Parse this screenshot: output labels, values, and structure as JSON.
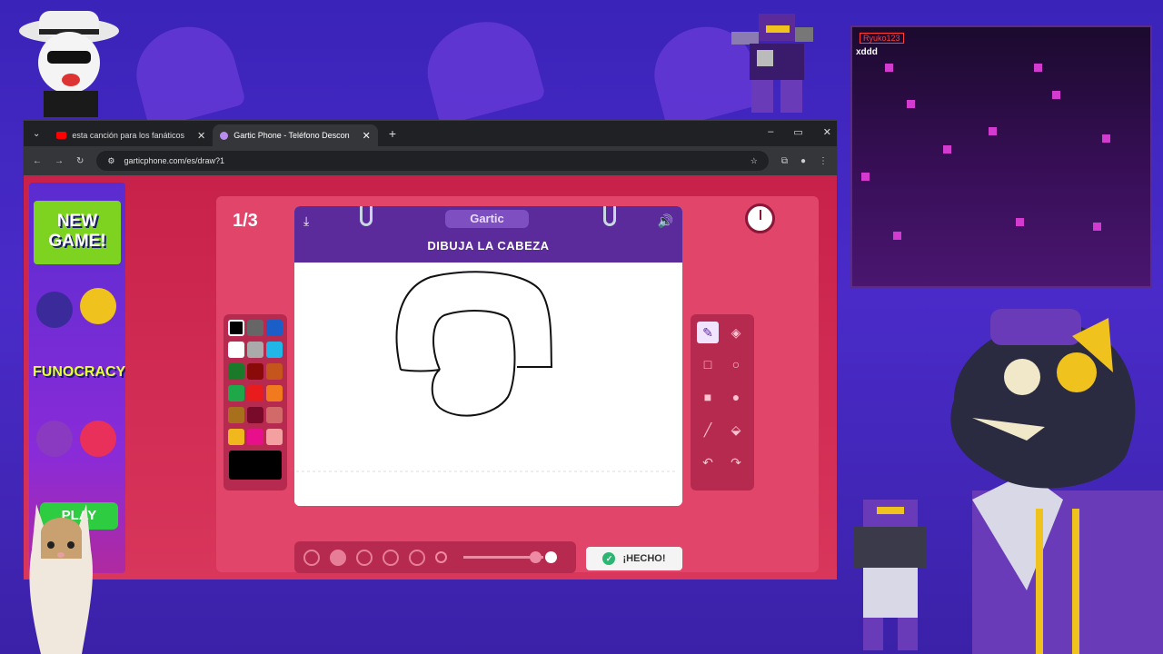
{
  "chat": {
    "username": "Ryuko123",
    "message": "xddd"
  },
  "browser": {
    "tabs": [
      {
        "label": "esta canción para los fanáticos",
        "icon": "youtube-icon",
        "active": false
      },
      {
        "label": "Gartic Phone - Teléfono Descon",
        "icon": "gartic-icon",
        "active": true
      }
    ],
    "new_tab": "+",
    "url": "garticphone.com/es/draw?1",
    "window_controls": [
      "–",
      "▭",
      "✕"
    ]
  },
  "ad": {
    "title": "NEW GAME!",
    "brand": "FUNOCRACY",
    "cta": "PLAY"
  },
  "game": {
    "round": "1/3",
    "logo": "Gartic",
    "prompt": "DIBUJA LA CABEZA",
    "done_label": "¡HECHO!",
    "selected_tool": "pencil",
    "current_color": "#000000",
    "palette": [
      "#000000",
      "#666666",
      "#1b5ec7",
      "#ffffff",
      "#aaaaaa",
      "#21b6e8",
      "#1a7a2a",
      "#8a0a0a",
      "#c4561d",
      "#1ea84a",
      "#e81c1c",
      "#f07a1d",
      "#a8701d",
      "#7a0a2a",
      "#d36a6a",
      "#f0b81d",
      "#e8108a",
      "#f5a0a0"
    ],
    "brush_sizes": 5,
    "selected_brush_size": 2,
    "opacity": 0.9
  },
  "colors": {
    "accent": "#5b2a9b",
    "page_bg": "#d9365c"
  }
}
